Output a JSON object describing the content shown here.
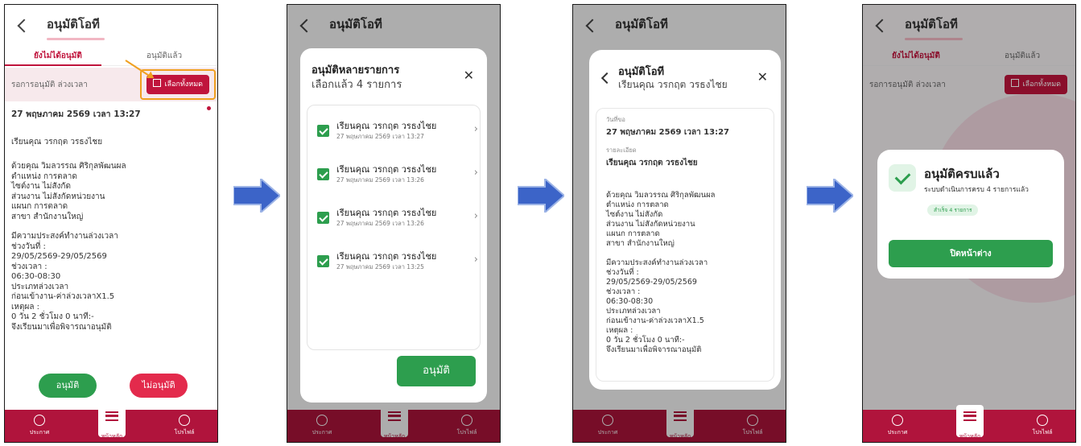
{
  "header": {
    "title": "อนุมัติโอที"
  },
  "tabs": {
    "pending": "ยังไม่ได้อนุมัติ",
    "approved": "อนุมัติแล้ว"
  },
  "filter": {
    "label": "รอการอนุมัติ ล่วงเวลา",
    "select_all": "เลือกทั้งหมด"
  },
  "request": {
    "datetime": "27 พฤษภาคม 2569 เวลา 13:27",
    "dear": "เรียนคุณ วรกฤต วรธงไชย",
    "body": [
      "ด้วยคุณ วิมลวรรณ ศิริกุลพัฒนผล",
      "ตำแหน่ง การตลาด",
      "ไซต์งาน ไม่สังกัด",
      "ส่วนงาน ไม่สังกัดหน่วยงาน",
      "แผนก การตลาด",
      "สาขา สำนักงานใหญ่"
    ],
    "detail": [
      "มีความประสงค์ทำงานล่วงเวลา",
      "ช่วงวันที่ :",
      "29/05/2569-29/05/2569",
      "ช่วงเวลา :",
      "06:30-08:30",
      "ประเภทล่วงเวลา",
      "ก่อนเข้างาน-ค่าล่วงเวลาX1.5",
      "เหตุผล :",
      "0 วัน 2 ชั่วโมง 0 นาที:-",
      "จึงเรียนมาเพื่อพิจารณาอนุมัติ"
    ]
  },
  "actions": {
    "approve": "อนุมัติ",
    "reject": "ไม่อนุมัติ"
  },
  "nav": {
    "news": "ประกาศ",
    "home": "หน้าหลัก",
    "profile": "โปรไฟล์"
  },
  "multi_modal": {
    "title": "อนุมัติหลายรายการ",
    "subtitle": "เลือกแล้ว 4 รายการ",
    "items": [
      {
        "name": "เรียนคุณ วรกฤต วรธงไชย",
        "date": "27 พฤษภาคม 2569 เวลา 13:27"
      },
      {
        "name": "เรียนคุณ วรกฤต วรธงไชย",
        "date": "27 พฤษภาคม 2569 เวลา 13:26"
      },
      {
        "name": "เรียนคุณ วรกฤต วรธงไชย",
        "date": "27 พฤษภาคม 2569 เวลา 13:26"
      },
      {
        "name": "เรียนคุณ วรกฤต วรธงไชย",
        "date": "27 พฤษภาคม 2569 เวลา 13:25"
      }
    ],
    "approve": "อนุมัติ"
  },
  "detail_modal": {
    "title": "อนุมัติโอที",
    "subtitle": "เรียนคุณ วรกฤต วรธงไชย",
    "date_label": "วันที่ขอ",
    "date_value": "27 พฤษภาคม 2569 เวลา 13:27",
    "detail_label": "รายละเอียด",
    "detail_name": "เรียนคุณ วรกฤต วรธงไชย"
  },
  "success": {
    "title": "อนุมัติครบแล้ว",
    "desc": "ระบบดำเนินการครบ 4 รายการแล้ว",
    "badge": "สำเร็จ 4 รายการ",
    "close": "ปิดหน้าต่าง"
  },
  "colors": {
    "primary": "#c0143c",
    "nav": "#b0143c",
    "success": "#2d9e4e",
    "reject": "#e32a4c",
    "highlight": "#f0a020",
    "arrow": "#3c64c8"
  }
}
